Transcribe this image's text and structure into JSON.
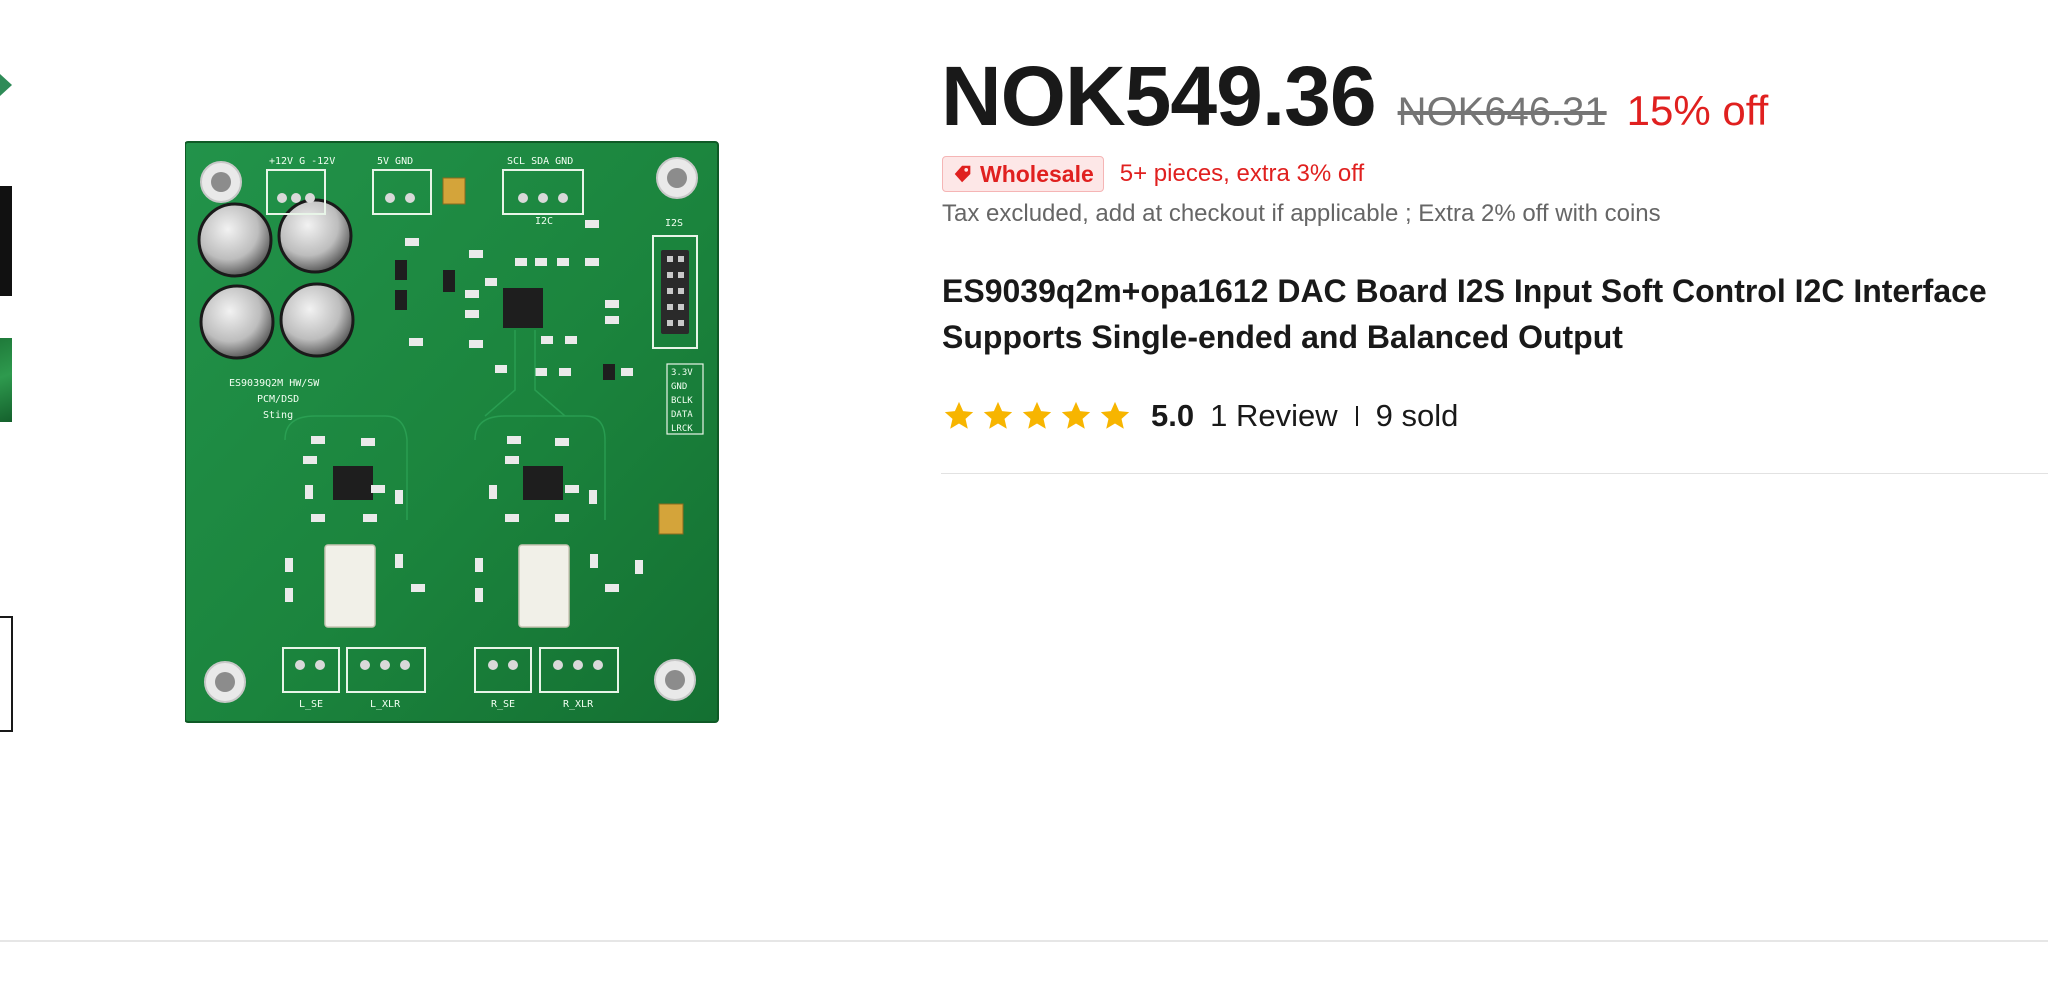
{
  "price": {
    "current": "NOK549.36",
    "original": "NOK646.31",
    "discount": "15% off"
  },
  "wholesale": {
    "badge_label": "Wholesale",
    "offer": "5+ pieces, extra 3% off"
  },
  "tax_note": "Tax excluded, add at checkout if applicable ; Extra 2% off with coins",
  "product": {
    "title": "ES9039q2m+opa1612 DAC Board I2S Input Soft Control I2C Interface Supports Single-ended and Balanced Output"
  },
  "rating": {
    "stars": 5,
    "value": "5.0",
    "reviews": "1 Review",
    "sold": "9 sold"
  },
  "pcb_silkscreen": {
    "board_name": "ES9039Q2M HW/SW",
    "board_sub": "PCM/DSD",
    "board_sub2": "Sting",
    "power_header": "+12V G -12V",
    "v5_header": "5V GND",
    "i2c_header": "SCL SDA GND",
    "i2c_label": "I2C",
    "i2s_label": "I2S",
    "i2s_pins": [
      "3.3V",
      "GND",
      "BCLK",
      "DATA",
      "LRCK"
    ],
    "out_labels": [
      "L_SE",
      "L_XLR",
      "R_SE",
      "R_XLR"
    ]
  },
  "colors": {
    "accent_red": "#e0201f",
    "pcb_green": "#1d8a3e",
    "star_yellow": "#f7b500"
  },
  "icons": {
    "tag": "tag-icon",
    "star": "star-icon"
  }
}
